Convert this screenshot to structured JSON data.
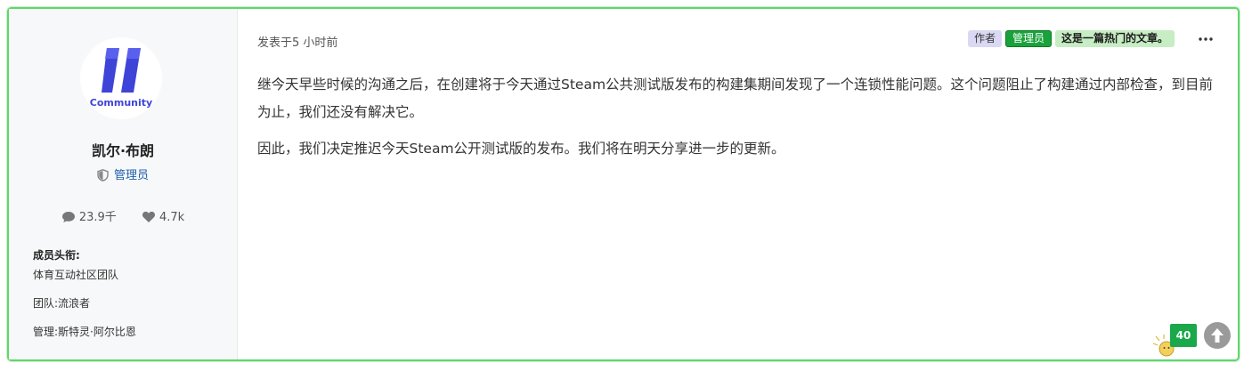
{
  "author": {
    "avatar_logo_text": "Community",
    "name": "凯尔·布朗",
    "role": "管理员",
    "stats": {
      "comments": "23.9千",
      "likes": "4.7k"
    },
    "member_title_label": "成员头衔:",
    "member_titles": [
      "体育互动社区团队",
      "团队:流浪者",
      "管理:斯特灵·阿尔比恩"
    ]
  },
  "post": {
    "posted_time": "发表于5 小时前",
    "badges": {
      "author": "作者",
      "admin": "管理员",
      "hot": "这是一篇热门的文章。"
    },
    "paragraphs": [
      "继今天早些时候的沟通之后，在创建将于今天通过Steam公共测试版发布的构建集期间发现了一个连锁性能问题。这个问题阻止了构建通过内部检查，到目前为止，我们还没有解决它。",
      "因此，我们决定推迟今天Steam公开测试版的发布。我们将在明天分享进一步的更新。"
    ],
    "vote_count": "40"
  },
  "colors": {
    "border_accent": "#62d66b",
    "admin_badge": "#19a23b",
    "hot_badge": "#c6edc3",
    "author_badge": "#d9d9f3",
    "logo": "#3e44d8"
  },
  "icons": [
    "community-logo",
    "shield-icon",
    "comment-icon",
    "heart-icon",
    "more-options-icon",
    "scroll-top-icon",
    "decorative-sticker-icon"
  ]
}
